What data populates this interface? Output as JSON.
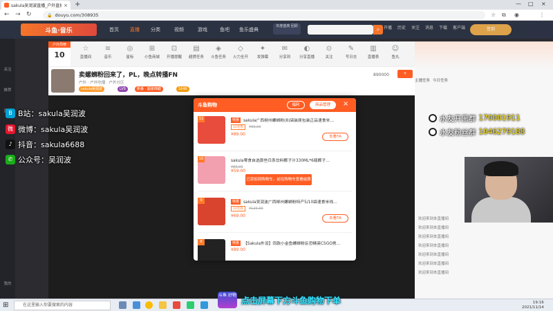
{
  "browser": {
    "tab_title": "sakula吴润波直播_户外直播_斗",
    "tab_close": "×",
    "new_tab": "+",
    "url": "douyu.com/308935",
    "window_controls": [
      "—",
      "□",
      "×"
    ]
  },
  "site": {
    "logo": "斗鱼·音乐",
    "nav": [
      "首页",
      "直播",
      "分类",
      "视频",
      "游戏",
      "鱼吧",
      "鱼乐盛典"
    ],
    "active_nav": "直播",
    "promo_badge": "年度盛典 回顾",
    "search_placeholder": "",
    "header_icons": [
      "开播",
      "历史",
      "关注",
      "消息",
      "下载",
      "客户端",
      "签到"
    ]
  },
  "left_sidebar": [
    "关注",
    "推荐",
    "直播",
    "我的"
  ],
  "room_tools": [
    {
      "icon": "☆",
      "label": "直播间"
    },
    {
      "icon": "≋",
      "label": "音乐"
    },
    {
      "icon": "◎",
      "label": "星标"
    },
    {
      "icon": "⊞",
      "label": "小鱼商城"
    },
    {
      "icon": "⊡",
      "label": "开播提醒"
    },
    {
      "icon": "▤",
      "label": "超燃任务"
    },
    {
      "icon": "◈",
      "label": "斗鱼任务"
    },
    {
      "icon": "◇",
      "label": "火力全开"
    },
    {
      "icon": "✦",
      "label": "发弹幕"
    },
    {
      "icon": "✉",
      "label": "分享到"
    },
    {
      "icon": "◐",
      "label": "分享直播"
    },
    {
      "icon": "⊙",
      "label": "关注"
    },
    {
      "icon": "✎",
      "label": "写日志"
    },
    {
      "icon": "▥",
      "label": "直播表"
    },
    {
      "icon": "☺",
      "label": "鱼丸"
    }
  ],
  "rank": {
    "label": "户外周榜",
    "value": "10"
  },
  "streamer": {
    "title": "卖螺蛳粉回来了，PL，晚点转播FN",
    "name": "sakula吴润波",
    "level": "LV9",
    "tags": "户外 · 户外吃播 · 户外分区",
    "stats": "新番 · 超级锦鲤",
    "fans": "1646",
    "fans_count": "890000"
  },
  "modal": {
    "title": "斗鱼购物",
    "coupon_btn": "福利",
    "manage_btn": "商品管理",
    "close": "×",
    "toast": "已添加到购物车，前往购物车查看结算 →",
    "see_label": "去看TA",
    "items": [
      {
        "num": "11",
        "tag": "特惠",
        "limit": "10元券",
        "title": "sakula广西柳州螺蛳粉(8)袋装原包装正品速食米…",
        "old": "¥99.00",
        "price": "¥89.00",
        "thumb_color": "#e84c3d"
      },
      {
        "num": "10",
        "tag": "特惠",
        "limit": "",
        "title": "sakula零食自选那些日系饮料椰子汁330ML*6瓶椰子…",
        "old": "¥89.00",
        "price": "¥59.00",
        "thumb_color": "#f2a0b0"
      },
      {
        "num": "9",
        "tag": "特惠",
        "limit": "10元券",
        "title": "sakula吴润波广西柳州螺蛳粉特产5/10袋速食米线…",
        "old": "¥129.00",
        "price": "¥69.00",
        "thumb_color": "#d9442f"
      },
      {
        "num": "8",
        "tag": "特惠",
        "limit": "",
        "title": "【Sakula外设】同款小金鱼螺蛳粉反恐精英CSGO男…",
        "old": "",
        "price": "¥89.00",
        "thumb_color": "#222222"
      }
    ]
  },
  "right": {
    "tabs": [
      "主播任务",
      "今日任务"
    ],
    "chat": [
      "欢迎来到本直播间",
      "欢迎来到本直播间",
      "欢迎来到本直播间",
      "欢迎来到本直播间",
      "欢迎来到本直播间",
      "欢迎来到本直播间",
      "欢迎来到本直播间"
    ],
    "side_text": "水友开黑群",
    "side_number": "170001911"
  },
  "overlay": {
    "qq_groups": [
      {
        "label": "水友开黑群",
        "number": "170001911"
      },
      {
        "label": "水友粉丝群",
        "number": "1046279188"
      }
    ],
    "socials": [
      {
        "icon": "B",
        "color": "#00a1d6",
        "text": "B站：sakula吴润波"
      },
      {
        "icon": "微",
        "color": "#e6162d",
        "text": "微博：sakula吴润波"
      },
      {
        "icon": "♪",
        "color": "#111111",
        "text": "抖音：sakula6688"
      },
      {
        "icon": "✆",
        "color": "#1aad19",
        "text": "公众号：吴润波"
      }
    ],
    "subtitle_badge": "斗鱼 好物",
    "subtitle": "点击屏幕下方斗鱼购物下单"
  },
  "taskbar": {
    "search_placeholder": "在这里输入你要搜索的内容",
    "time": "19:16",
    "date": "2021/11/14"
  }
}
